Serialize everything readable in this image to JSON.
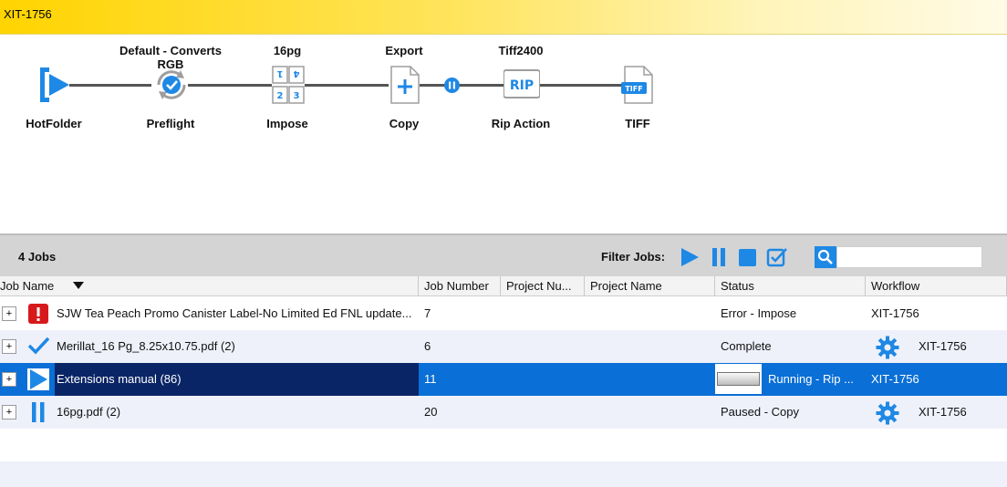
{
  "window": {
    "title": "XIT-1756"
  },
  "workflow": {
    "nodes": [
      {
        "top": "",
        "bottom": "HotFolder",
        "icon": "hotfolder-icon"
      },
      {
        "top": "Default - Converts RGB",
        "bottom": "Preflight",
        "icon": "preflight-icon"
      },
      {
        "top": "16pg",
        "bottom": "Impose",
        "icon": "impose-icon"
      },
      {
        "top": "Export",
        "bottom": "Copy",
        "icon": "copy-icon"
      },
      {
        "top": "Tiff2400",
        "bottom": "Rip Action",
        "icon": "rip-icon"
      },
      {
        "top": "",
        "bottom": "TIFF",
        "icon": "tiff-icon"
      }
    ]
  },
  "jobs_bar": {
    "count": "4 Jobs",
    "filter_label": "Filter Jobs:",
    "search_placeholder": ""
  },
  "columns": [
    "Job Name",
    "Job Number",
    "Project Nu...",
    "Project Name",
    "Status",
    "Workflow"
  ],
  "rows": [
    {
      "name": "SJW Tea Peach Promo Canister Label-No Limited Ed FNL update...",
      "number": "7",
      "status": "Error - Impose",
      "workflow": "XIT-1756",
      "state": "error",
      "gear": false
    },
    {
      "name": "Merillat_16 Pg_8.25x10.75.pdf (2)",
      "number": "6",
      "status": "Complete",
      "workflow": "XIT-1756",
      "state": "complete",
      "gear": true
    },
    {
      "name": "Extensions manual (86)",
      "number": "11",
      "status": "Running - Rip ...",
      "workflow": "XIT-1756",
      "state": "running",
      "gear": false
    },
    {
      "name": "16pg.pdf (2)",
      "number": "20",
      "status": "Paused - Copy",
      "workflow": "XIT-1756",
      "state": "paused",
      "gear": true
    }
  ],
  "colors": {
    "accent": "#1e88e5",
    "selection": "#0a6fd6",
    "selection_dark": "#0a2566",
    "error": "#d7191c",
    "titlebar": "#ffd400"
  }
}
